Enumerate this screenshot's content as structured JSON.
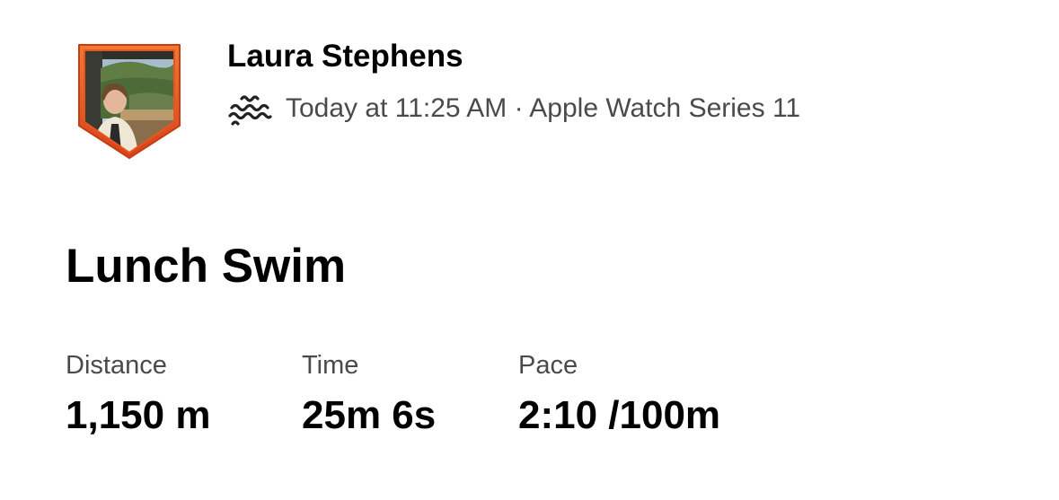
{
  "athlete": {
    "name": "Laura Stephens",
    "badge_color": "#e8551f"
  },
  "activity": {
    "sport_icon": "swim-icon",
    "meta": "Today at 11:25 AM · Apple Watch Series 11",
    "title": "Lunch Swim"
  },
  "stats": [
    {
      "label": "Distance",
      "value": "1,150 m"
    },
    {
      "label": "Time",
      "value": "25m 6s"
    },
    {
      "label": "Pace",
      "value": "2:10 /100m"
    }
  ]
}
